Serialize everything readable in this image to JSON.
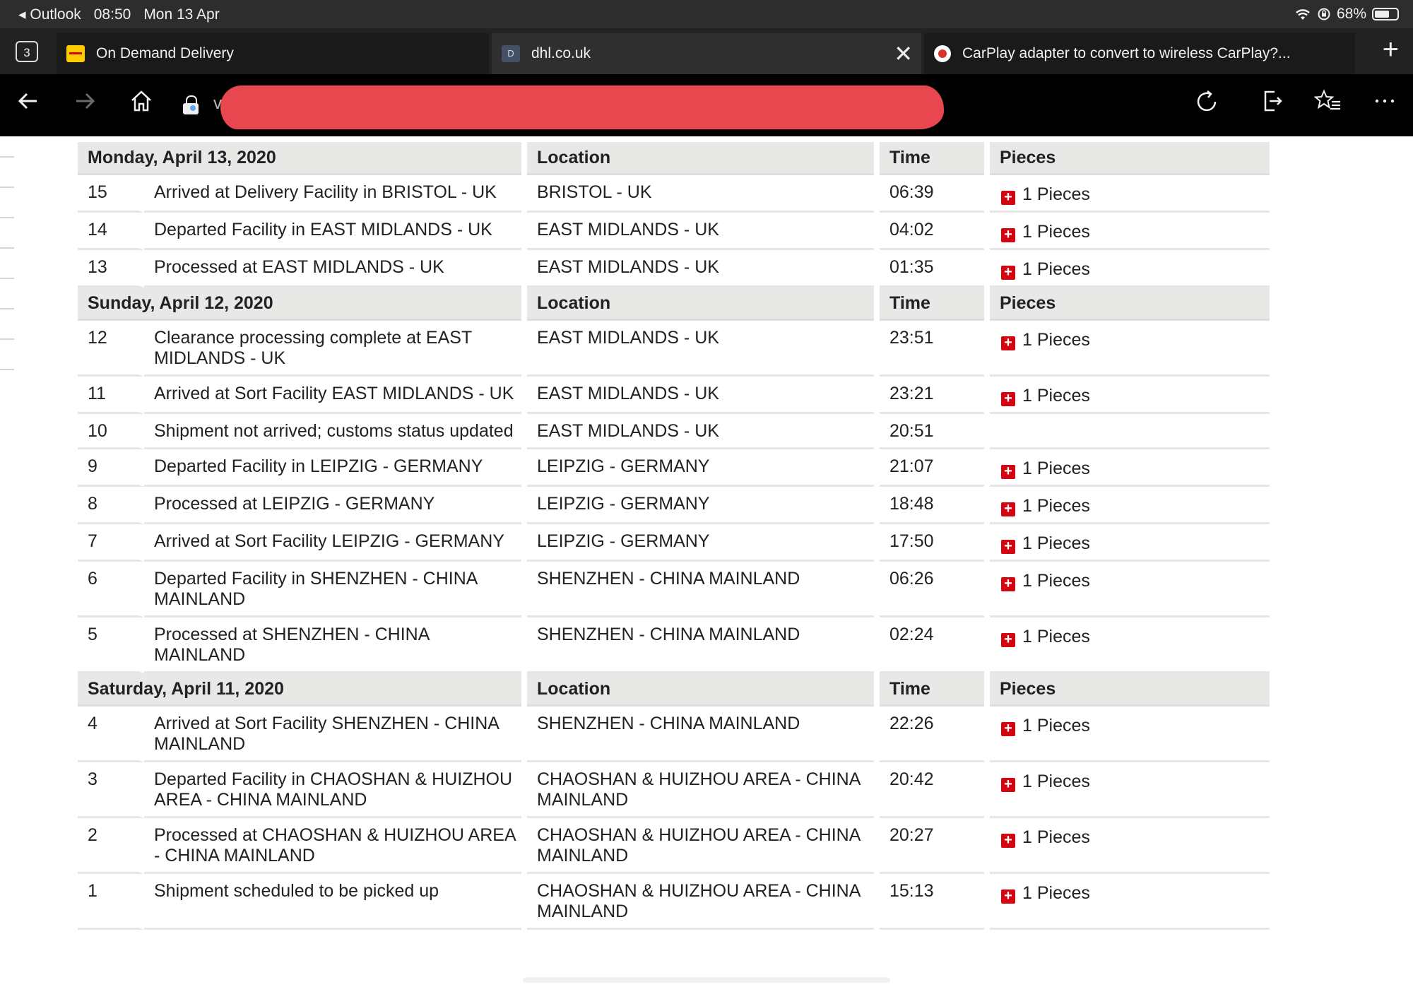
{
  "status_bar": {
    "back_app": "◂ Outlook",
    "time": "08:50",
    "date": "Mon 13 Apr",
    "battery": "68%",
    "battery_level": 0.68
  },
  "tabs": {
    "count": "3",
    "items": [
      {
        "label": "On Demand Delivery",
        "icon": "dhl-favicon-icon"
      },
      {
        "label": "dhl.co.uk",
        "icon": "d-favicon-icon"
      },
      {
        "label": "CarPlay adapter to convert to wireless CarPlay?...",
        "icon": "carplay-favicon-icon"
      }
    ],
    "new_tab": "+"
  },
  "toolbar": {
    "url_visible_prefix": "v"
  },
  "tracking": {
    "days": [
      {
        "date": "Monday, April 13, 2020",
        "headers": {
          "location": "Location",
          "time": "Time",
          "pieces": "Pieces"
        },
        "events": [
          {
            "num": "15",
            "desc": "Arrived at Delivery Facility in BRISTOL - UK",
            "loc": "BRISTOL - UK",
            "time": "06:39",
            "pieces": "1 Pieces"
          },
          {
            "num": "14",
            "desc": "Departed Facility in EAST MIDLANDS - UK",
            "loc": "EAST MIDLANDS - UK",
            "time": "04:02",
            "pieces": "1 Pieces"
          },
          {
            "num": "13",
            "desc": "Processed at EAST MIDLANDS - UK",
            "loc": "EAST MIDLANDS - UK",
            "time": "01:35",
            "pieces": "1 Pieces"
          }
        ]
      },
      {
        "date": "Sunday, April 12, 2020",
        "headers": {
          "location": "Location",
          "time": "Time",
          "pieces": "Pieces"
        },
        "events": [
          {
            "num": "12",
            "desc": "Clearance processing complete at EAST MIDLANDS - UK",
            "loc": "EAST MIDLANDS - UK",
            "time": "23:51",
            "pieces": "1 Pieces"
          },
          {
            "num": "11",
            "desc": "Arrived at Sort Facility EAST MIDLANDS - UK",
            "loc": "EAST MIDLANDS - UK",
            "time": "23:21",
            "pieces": "1 Pieces"
          },
          {
            "num": "10",
            "desc": "Shipment not arrived; customs status updated",
            "loc": "EAST MIDLANDS - UK",
            "time": "20:51",
            "pieces": ""
          },
          {
            "num": "9",
            "desc": "Departed Facility in LEIPZIG - GERMANY",
            "loc": "LEIPZIG - GERMANY",
            "time": "21:07",
            "pieces": "1 Pieces"
          },
          {
            "num": "8",
            "desc": "Processed at LEIPZIG - GERMANY",
            "loc": "LEIPZIG - GERMANY",
            "time": "18:48",
            "pieces": "1 Pieces"
          },
          {
            "num": "7",
            "desc": "Arrived at Sort Facility LEIPZIG - GERMANY",
            "loc": "LEIPZIG - GERMANY",
            "time": "17:50",
            "pieces": "1 Pieces"
          },
          {
            "num": "6",
            "desc": "Departed Facility in SHENZHEN - CHINA MAINLAND",
            "loc": "SHENZHEN - CHINA MAINLAND",
            "time": "06:26",
            "pieces": "1 Pieces"
          },
          {
            "num": "5",
            "desc": "Processed at SHENZHEN - CHINA MAINLAND",
            "loc": "SHENZHEN - CHINA MAINLAND",
            "time": "02:24",
            "pieces": "1 Pieces"
          }
        ]
      },
      {
        "date": "Saturday, April 11, 2020",
        "headers": {
          "location": "Location",
          "time": "Time",
          "pieces": "Pieces"
        },
        "events": [
          {
            "num": "4",
            "desc": "Arrived at Sort Facility SHENZHEN - CHINA MAINLAND",
            "loc": "SHENZHEN - CHINA MAINLAND",
            "time": "22:26",
            "pieces": "1 Pieces"
          },
          {
            "num": "3",
            "desc": "Departed Facility in CHAOSHAN & HUIZHOU AREA - CHINA MAINLAND",
            "loc": "CHAOSHAN & HUIZHOU AREA - CHINA MAINLAND",
            "time": "20:42",
            "pieces": "1 Pieces"
          },
          {
            "num": "2",
            "desc": "Processed at CHAOSHAN & HUIZHOU AREA - CHINA MAINLAND",
            "loc": "CHAOSHAN & HUIZHOU AREA - CHINA MAINLAND",
            "time": "20:27",
            "pieces": "1 Pieces"
          },
          {
            "num": "1",
            "desc": "Shipment scheduled to be picked up",
            "loc": "CHAOSHAN & HUIZHOU AREA - CHINA MAINLAND",
            "time": "15:13",
            "pieces": "1 Pieces"
          }
        ]
      }
    ]
  },
  "colors": {
    "tab_bar": "#222222",
    "toolbar": "#000000",
    "header_row": "#e8e8e6",
    "dhl_red": "#d40511",
    "redaction": "#e8474f"
  }
}
